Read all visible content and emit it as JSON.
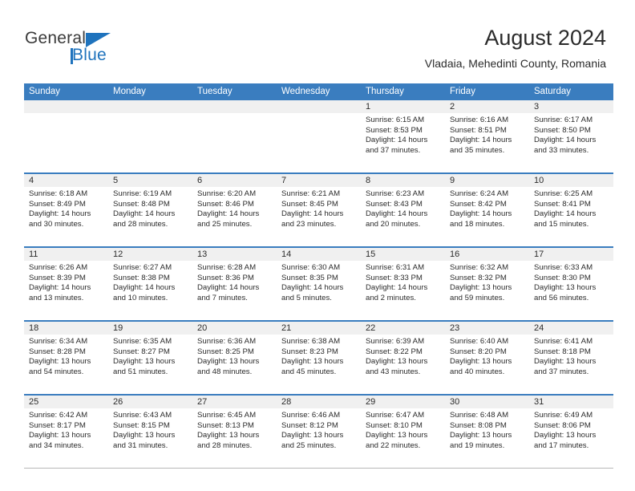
{
  "brand": {
    "name_part1": "General",
    "name_part2": "Blue",
    "accent_color": "#1f73bd"
  },
  "header": {
    "title": "August 2024",
    "location": "Vladaia, Mehedinti County, Romania"
  },
  "calendar": {
    "header_color": "#3a7dbf",
    "weekday_headers": [
      "Sunday",
      "Monday",
      "Tuesday",
      "Wednesday",
      "Thursday",
      "Friday",
      "Saturday"
    ],
    "weeks": [
      [
        {
          "day": "",
          "sunrise": "",
          "sunset": "",
          "daylight_line1": "",
          "daylight_line2": ""
        },
        {
          "day": "",
          "sunrise": "",
          "sunset": "",
          "daylight_line1": "",
          "daylight_line2": ""
        },
        {
          "day": "",
          "sunrise": "",
          "sunset": "",
          "daylight_line1": "",
          "daylight_line2": ""
        },
        {
          "day": "",
          "sunrise": "",
          "sunset": "",
          "daylight_line1": "",
          "daylight_line2": ""
        },
        {
          "day": "1",
          "sunrise": "Sunrise: 6:15 AM",
          "sunset": "Sunset: 8:53 PM",
          "daylight_line1": "Daylight: 14 hours",
          "daylight_line2": "and 37 minutes."
        },
        {
          "day": "2",
          "sunrise": "Sunrise: 6:16 AM",
          "sunset": "Sunset: 8:51 PM",
          "daylight_line1": "Daylight: 14 hours",
          "daylight_line2": "and 35 minutes."
        },
        {
          "day": "3",
          "sunrise": "Sunrise: 6:17 AM",
          "sunset": "Sunset: 8:50 PM",
          "daylight_line1": "Daylight: 14 hours",
          "daylight_line2": "and 33 minutes."
        }
      ],
      [
        {
          "day": "4",
          "sunrise": "Sunrise: 6:18 AM",
          "sunset": "Sunset: 8:49 PM",
          "daylight_line1": "Daylight: 14 hours",
          "daylight_line2": "and 30 minutes."
        },
        {
          "day": "5",
          "sunrise": "Sunrise: 6:19 AM",
          "sunset": "Sunset: 8:48 PM",
          "daylight_line1": "Daylight: 14 hours",
          "daylight_line2": "and 28 minutes."
        },
        {
          "day": "6",
          "sunrise": "Sunrise: 6:20 AM",
          "sunset": "Sunset: 8:46 PM",
          "daylight_line1": "Daylight: 14 hours",
          "daylight_line2": "and 25 minutes."
        },
        {
          "day": "7",
          "sunrise": "Sunrise: 6:21 AM",
          "sunset": "Sunset: 8:45 PM",
          "daylight_line1": "Daylight: 14 hours",
          "daylight_line2": "and 23 minutes."
        },
        {
          "day": "8",
          "sunrise": "Sunrise: 6:23 AM",
          "sunset": "Sunset: 8:43 PM",
          "daylight_line1": "Daylight: 14 hours",
          "daylight_line2": "and 20 minutes."
        },
        {
          "day": "9",
          "sunrise": "Sunrise: 6:24 AM",
          "sunset": "Sunset: 8:42 PM",
          "daylight_line1": "Daylight: 14 hours",
          "daylight_line2": "and 18 minutes."
        },
        {
          "day": "10",
          "sunrise": "Sunrise: 6:25 AM",
          "sunset": "Sunset: 8:41 PM",
          "daylight_line1": "Daylight: 14 hours",
          "daylight_line2": "and 15 minutes."
        }
      ],
      [
        {
          "day": "11",
          "sunrise": "Sunrise: 6:26 AM",
          "sunset": "Sunset: 8:39 PM",
          "daylight_line1": "Daylight: 14 hours",
          "daylight_line2": "and 13 minutes."
        },
        {
          "day": "12",
          "sunrise": "Sunrise: 6:27 AM",
          "sunset": "Sunset: 8:38 PM",
          "daylight_line1": "Daylight: 14 hours",
          "daylight_line2": "and 10 minutes."
        },
        {
          "day": "13",
          "sunrise": "Sunrise: 6:28 AM",
          "sunset": "Sunset: 8:36 PM",
          "daylight_line1": "Daylight: 14 hours",
          "daylight_line2": "and 7 minutes."
        },
        {
          "day": "14",
          "sunrise": "Sunrise: 6:30 AM",
          "sunset": "Sunset: 8:35 PM",
          "daylight_line1": "Daylight: 14 hours",
          "daylight_line2": "and 5 minutes."
        },
        {
          "day": "15",
          "sunrise": "Sunrise: 6:31 AM",
          "sunset": "Sunset: 8:33 PM",
          "daylight_line1": "Daylight: 14 hours",
          "daylight_line2": "and 2 minutes."
        },
        {
          "day": "16",
          "sunrise": "Sunrise: 6:32 AM",
          "sunset": "Sunset: 8:32 PM",
          "daylight_line1": "Daylight: 13 hours",
          "daylight_line2": "and 59 minutes."
        },
        {
          "day": "17",
          "sunrise": "Sunrise: 6:33 AM",
          "sunset": "Sunset: 8:30 PM",
          "daylight_line1": "Daylight: 13 hours",
          "daylight_line2": "and 56 minutes."
        }
      ],
      [
        {
          "day": "18",
          "sunrise": "Sunrise: 6:34 AM",
          "sunset": "Sunset: 8:28 PM",
          "daylight_line1": "Daylight: 13 hours",
          "daylight_line2": "and 54 minutes."
        },
        {
          "day": "19",
          "sunrise": "Sunrise: 6:35 AM",
          "sunset": "Sunset: 8:27 PM",
          "daylight_line1": "Daylight: 13 hours",
          "daylight_line2": "and 51 minutes."
        },
        {
          "day": "20",
          "sunrise": "Sunrise: 6:36 AM",
          "sunset": "Sunset: 8:25 PM",
          "daylight_line1": "Daylight: 13 hours",
          "daylight_line2": "and 48 minutes."
        },
        {
          "day": "21",
          "sunrise": "Sunrise: 6:38 AM",
          "sunset": "Sunset: 8:23 PM",
          "daylight_line1": "Daylight: 13 hours",
          "daylight_line2": "and 45 minutes."
        },
        {
          "day": "22",
          "sunrise": "Sunrise: 6:39 AM",
          "sunset": "Sunset: 8:22 PM",
          "daylight_line1": "Daylight: 13 hours",
          "daylight_line2": "and 43 minutes."
        },
        {
          "day": "23",
          "sunrise": "Sunrise: 6:40 AM",
          "sunset": "Sunset: 8:20 PM",
          "daylight_line1": "Daylight: 13 hours",
          "daylight_line2": "and 40 minutes."
        },
        {
          "day": "24",
          "sunrise": "Sunrise: 6:41 AM",
          "sunset": "Sunset: 8:18 PM",
          "daylight_line1": "Daylight: 13 hours",
          "daylight_line2": "and 37 minutes."
        }
      ],
      [
        {
          "day": "25",
          "sunrise": "Sunrise: 6:42 AM",
          "sunset": "Sunset: 8:17 PM",
          "daylight_line1": "Daylight: 13 hours",
          "daylight_line2": "and 34 minutes."
        },
        {
          "day": "26",
          "sunrise": "Sunrise: 6:43 AM",
          "sunset": "Sunset: 8:15 PM",
          "daylight_line1": "Daylight: 13 hours",
          "daylight_line2": "and 31 minutes."
        },
        {
          "day": "27",
          "sunrise": "Sunrise: 6:45 AM",
          "sunset": "Sunset: 8:13 PM",
          "daylight_line1": "Daylight: 13 hours",
          "daylight_line2": "and 28 minutes."
        },
        {
          "day": "28",
          "sunrise": "Sunrise: 6:46 AM",
          "sunset": "Sunset: 8:12 PM",
          "daylight_line1": "Daylight: 13 hours",
          "daylight_line2": "and 25 minutes."
        },
        {
          "day": "29",
          "sunrise": "Sunrise: 6:47 AM",
          "sunset": "Sunset: 8:10 PM",
          "daylight_line1": "Daylight: 13 hours",
          "daylight_line2": "and 22 minutes."
        },
        {
          "day": "30",
          "sunrise": "Sunrise: 6:48 AM",
          "sunset": "Sunset: 8:08 PM",
          "daylight_line1": "Daylight: 13 hours",
          "daylight_line2": "and 19 minutes."
        },
        {
          "day": "31",
          "sunrise": "Sunrise: 6:49 AM",
          "sunset": "Sunset: 8:06 PM",
          "daylight_line1": "Daylight: 13 hours",
          "daylight_line2": "and 17 minutes."
        }
      ]
    ]
  }
}
